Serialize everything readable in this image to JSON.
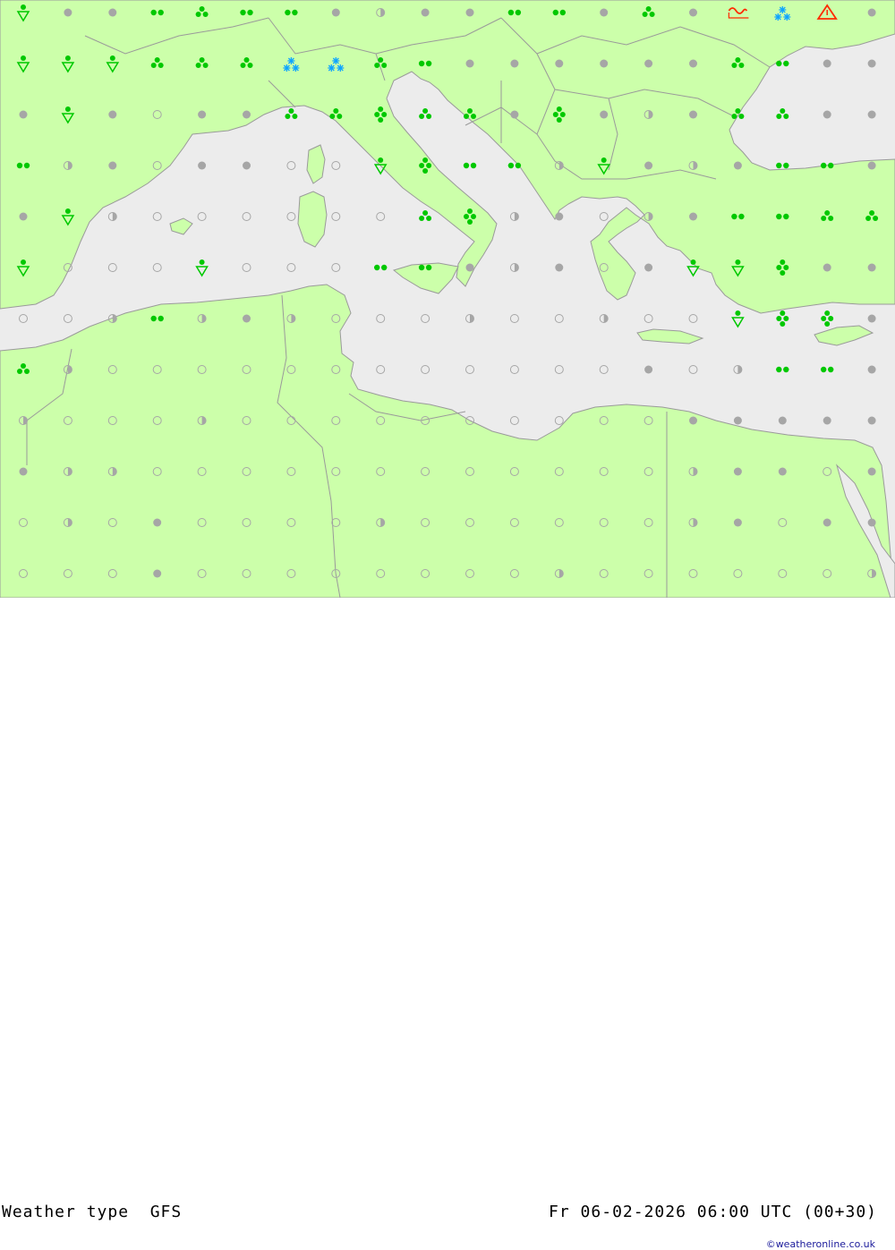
{
  "map": {
    "colors": {
      "land": "#ccffaa",
      "sea": "#ececec",
      "border": "#9a9a9a",
      "cloud": "#a6a6a6",
      "precip": "#00c800",
      "snow": "#0fa5ff",
      "warning": "#ff2a00"
    },
    "grid": {
      "columns": 20,
      "rows": 12,
      "symbols": [
        "s,c,c,d,b,d,d,c,h,c,c,d,d,c,b,c,f,n,w,c",
        "s,s,s,r,r,r,n,n,r,d,c,c,c,c,c,c,r,d,c,c",
        "c,s,c,o,c,c,r,r,R,b,b,c,R,c,h,c,r,r,c,c",
        "d,h,c,o,c,c,o,o,s,R,d,d,h,s,c,h,c,d,d,c",
        "c,s,h,o,o,o,o,o,o,r,R,h,c,o,h,c,d,d,r,r",
        "s,o,o,o,s,o,o,o,d,d,c,h,c,o,c,s,s,R,c,c",
        "o,o,h,d,h,c,h,o,o,o,h,o,o,h,o,o,s,R,R,c",
        "r,h,o,o,o,o,o,o,o,o,o,o,o,o,c,o,h,d,d,c",
        "h,o,o,o,h,o,o,o,o,o,o,o,o,o,o,c,c,c,c,c",
        "c,h,h,o,o,o,o,o,o,o,o,o,o,o,o,h,c,c,o,c",
        "o,h,o,c,o,o,o,o,h,o,o,o,o,o,o,h,c,o,c,c",
        "o,o,o,c,o,o,o,o,o,o,o,o,h,o,o,o,o,o,o,h"
      ]
    }
  },
  "footer": {
    "title": "Weather type  GFS",
    "datetime": "Fr 06-02-2026 06:00 UTC (00+30)",
    "credit": "©weatheronline.co.uk"
  }
}
